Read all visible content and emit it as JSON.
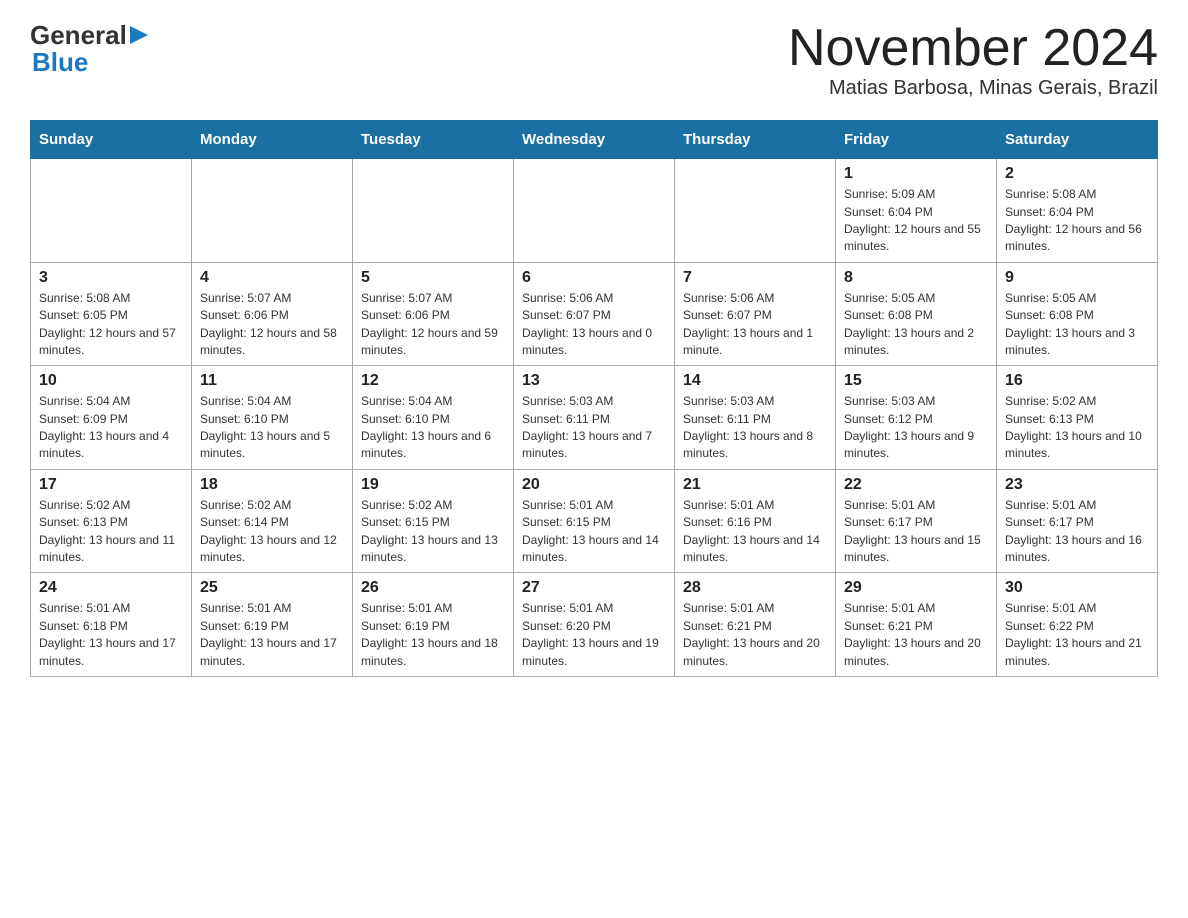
{
  "header": {
    "logo_general": "General",
    "logo_blue": "Blue",
    "month_title": "November 2024",
    "location": "Matias Barbosa, Minas Gerais, Brazil"
  },
  "days_of_week": [
    "Sunday",
    "Monday",
    "Tuesday",
    "Wednesday",
    "Thursday",
    "Friday",
    "Saturday"
  ],
  "weeks": [
    [
      {
        "day": "",
        "sunrise": "",
        "sunset": "",
        "daylight": ""
      },
      {
        "day": "",
        "sunrise": "",
        "sunset": "",
        "daylight": ""
      },
      {
        "day": "",
        "sunrise": "",
        "sunset": "",
        "daylight": ""
      },
      {
        "day": "",
        "sunrise": "",
        "sunset": "",
        "daylight": ""
      },
      {
        "day": "",
        "sunrise": "",
        "sunset": "",
        "daylight": ""
      },
      {
        "day": "1",
        "sunrise": "Sunrise: 5:09 AM",
        "sunset": "Sunset: 6:04 PM",
        "daylight": "Daylight: 12 hours and 55 minutes."
      },
      {
        "day": "2",
        "sunrise": "Sunrise: 5:08 AM",
        "sunset": "Sunset: 6:04 PM",
        "daylight": "Daylight: 12 hours and 56 minutes."
      }
    ],
    [
      {
        "day": "3",
        "sunrise": "Sunrise: 5:08 AM",
        "sunset": "Sunset: 6:05 PM",
        "daylight": "Daylight: 12 hours and 57 minutes."
      },
      {
        "day": "4",
        "sunrise": "Sunrise: 5:07 AM",
        "sunset": "Sunset: 6:06 PM",
        "daylight": "Daylight: 12 hours and 58 minutes."
      },
      {
        "day": "5",
        "sunrise": "Sunrise: 5:07 AM",
        "sunset": "Sunset: 6:06 PM",
        "daylight": "Daylight: 12 hours and 59 minutes."
      },
      {
        "day": "6",
        "sunrise": "Sunrise: 5:06 AM",
        "sunset": "Sunset: 6:07 PM",
        "daylight": "Daylight: 13 hours and 0 minutes."
      },
      {
        "day": "7",
        "sunrise": "Sunrise: 5:06 AM",
        "sunset": "Sunset: 6:07 PM",
        "daylight": "Daylight: 13 hours and 1 minute."
      },
      {
        "day": "8",
        "sunrise": "Sunrise: 5:05 AM",
        "sunset": "Sunset: 6:08 PM",
        "daylight": "Daylight: 13 hours and 2 minutes."
      },
      {
        "day": "9",
        "sunrise": "Sunrise: 5:05 AM",
        "sunset": "Sunset: 6:08 PM",
        "daylight": "Daylight: 13 hours and 3 minutes."
      }
    ],
    [
      {
        "day": "10",
        "sunrise": "Sunrise: 5:04 AM",
        "sunset": "Sunset: 6:09 PM",
        "daylight": "Daylight: 13 hours and 4 minutes."
      },
      {
        "day": "11",
        "sunrise": "Sunrise: 5:04 AM",
        "sunset": "Sunset: 6:10 PM",
        "daylight": "Daylight: 13 hours and 5 minutes."
      },
      {
        "day": "12",
        "sunrise": "Sunrise: 5:04 AM",
        "sunset": "Sunset: 6:10 PM",
        "daylight": "Daylight: 13 hours and 6 minutes."
      },
      {
        "day": "13",
        "sunrise": "Sunrise: 5:03 AM",
        "sunset": "Sunset: 6:11 PM",
        "daylight": "Daylight: 13 hours and 7 minutes."
      },
      {
        "day": "14",
        "sunrise": "Sunrise: 5:03 AM",
        "sunset": "Sunset: 6:11 PM",
        "daylight": "Daylight: 13 hours and 8 minutes."
      },
      {
        "day": "15",
        "sunrise": "Sunrise: 5:03 AM",
        "sunset": "Sunset: 6:12 PM",
        "daylight": "Daylight: 13 hours and 9 minutes."
      },
      {
        "day": "16",
        "sunrise": "Sunrise: 5:02 AM",
        "sunset": "Sunset: 6:13 PM",
        "daylight": "Daylight: 13 hours and 10 minutes."
      }
    ],
    [
      {
        "day": "17",
        "sunrise": "Sunrise: 5:02 AM",
        "sunset": "Sunset: 6:13 PM",
        "daylight": "Daylight: 13 hours and 11 minutes."
      },
      {
        "day": "18",
        "sunrise": "Sunrise: 5:02 AM",
        "sunset": "Sunset: 6:14 PM",
        "daylight": "Daylight: 13 hours and 12 minutes."
      },
      {
        "day": "19",
        "sunrise": "Sunrise: 5:02 AM",
        "sunset": "Sunset: 6:15 PM",
        "daylight": "Daylight: 13 hours and 13 minutes."
      },
      {
        "day": "20",
        "sunrise": "Sunrise: 5:01 AM",
        "sunset": "Sunset: 6:15 PM",
        "daylight": "Daylight: 13 hours and 14 minutes."
      },
      {
        "day": "21",
        "sunrise": "Sunrise: 5:01 AM",
        "sunset": "Sunset: 6:16 PM",
        "daylight": "Daylight: 13 hours and 14 minutes."
      },
      {
        "day": "22",
        "sunrise": "Sunrise: 5:01 AM",
        "sunset": "Sunset: 6:17 PM",
        "daylight": "Daylight: 13 hours and 15 minutes."
      },
      {
        "day": "23",
        "sunrise": "Sunrise: 5:01 AM",
        "sunset": "Sunset: 6:17 PM",
        "daylight": "Daylight: 13 hours and 16 minutes."
      }
    ],
    [
      {
        "day": "24",
        "sunrise": "Sunrise: 5:01 AM",
        "sunset": "Sunset: 6:18 PM",
        "daylight": "Daylight: 13 hours and 17 minutes."
      },
      {
        "day": "25",
        "sunrise": "Sunrise: 5:01 AM",
        "sunset": "Sunset: 6:19 PM",
        "daylight": "Daylight: 13 hours and 17 minutes."
      },
      {
        "day": "26",
        "sunrise": "Sunrise: 5:01 AM",
        "sunset": "Sunset: 6:19 PM",
        "daylight": "Daylight: 13 hours and 18 minutes."
      },
      {
        "day": "27",
        "sunrise": "Sunrise: 5:01 AM",
        "sunset": "Sunset: 6:20 PM",
        "daylight": "Daylight: 13 hours and 19 minutes."
      },
      {
        "day": "28",
        "sunrise": "Sunrise: 5:01 AM",
        "sunset": "Sunset: 6:21 PM",
        "daylight": "Daylight: 13 hours and 20 minutes."
      },
      {
        "day": "29",
        "sunrise": "Sunrise: 5:01 AM",
        "sunset": "Sunset: 6:21 PM",
        "daylight": "Daylight: 13 hours and 20 minutes."
      },
      {
        "day": "30",
        "sunrise": "Sunrise: 5:01 AM",
        "sunset": "Sunset: 6:22 PM",
        "daylight": "Daylight: 13 hours and 21 minutes."
      }
    ]
  ]
}
